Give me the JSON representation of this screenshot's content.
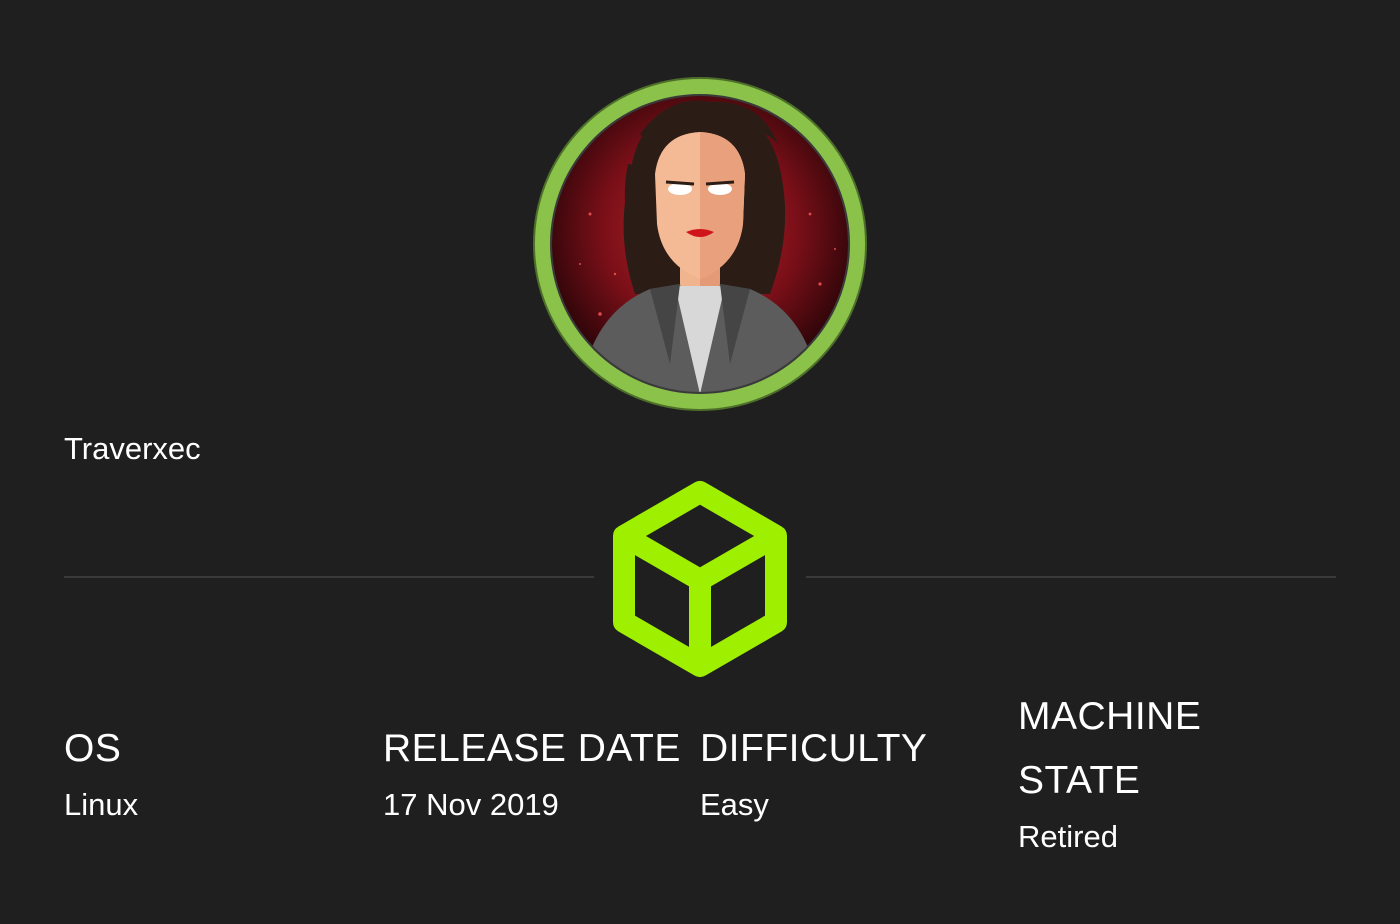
{
  "machine": {
    "name": "Traverxec",
    "avatar_icon": "avatar-woman-icon",
    "type_icon": "cube-icon"
  },
  "stats": {
    "os": {
      "label": "OS",
      "value": "Linux"
    },
    "release_date": {
      "label": "RELEASE DATE",
      "value": "17 Nov 2019"
    },
    "difficulty": {
      "label": "DIFFICULTY",
      "value": "Easy"
    },
    "machine_state": {
      "label": "MACHINE STATE",
      "value": "Retired"
    }
  },
  "colors": {
    "background": "#1f1f1f",
    "accent_green": "#8bc34a",
    "cube_green": "#9fef00",
    "divider": "#3a3a3a",
    "text": "#ffffff"
  }
}
